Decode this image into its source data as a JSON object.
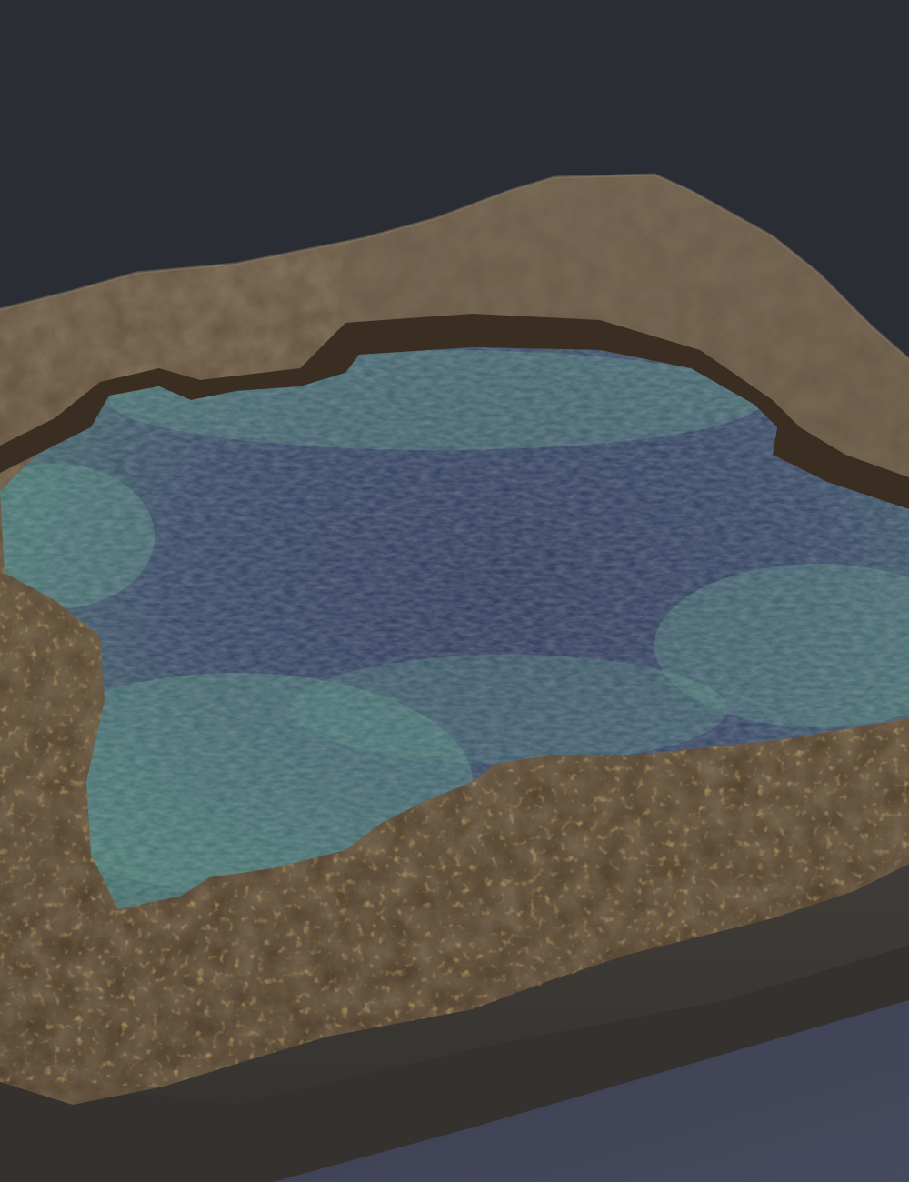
{
  "scene": {
    "subject": "rock-pool-render",
    "colors": {
      "background": "#2a2d33",
      "rock_light": "#6b5b47",
      "rock_mid": "#4f4130",
      "rock_dark": "#2e241a",
      "lichen": "#b8862f",
      "water_deep": "#2b3656",
      "water_mid": "#354566",
      "water_shallow": "#3f6a66",
      "algae": "#4f8577",
      "slab_side": "#3f3c38",
      "slab_shadow": "#34312e",
      "floor": "#3c3f4f"
    }
  }
}
